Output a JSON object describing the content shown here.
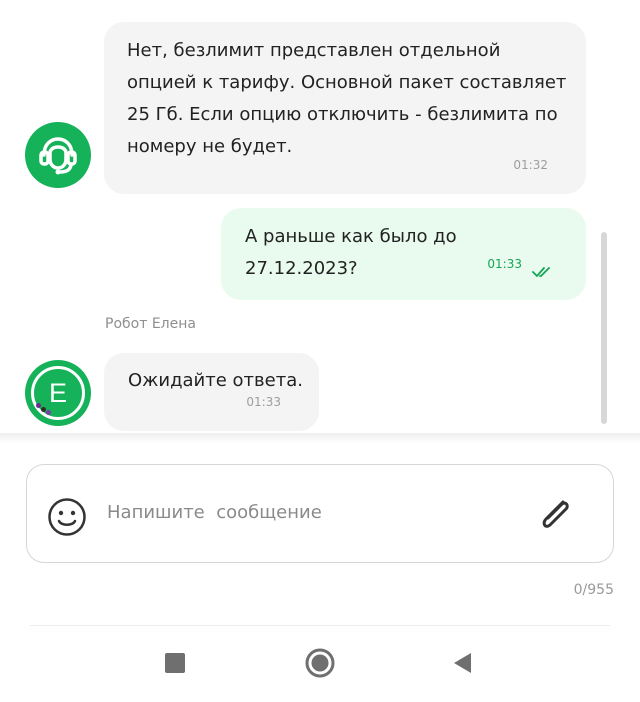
{
  "colors": {
    "brand_green": "#16b25a",
    "incoming_bubble": "#f4f4f4",
    "outgoing_bubble": "#e9fbee",
    "status_read": "#16a556"
  },
  "messages": [
    {
      "direction": "incoming",
      "avatar_icon": "operator-headset-icon",
      "text": "Нет, безлимит представлен отдельной опцией к тарифу. Основной пакет составляет 25 Гб. Если опцию отключить - безлимита по номеру не будет.",
      "lines": [
        "Нет, безлимит представлен отдельной",
        "опцией к тарифу. Основной пакет составляет",
        "25 Гб. Если опцию отключить - безлимита по",
        "номеру не будет."
      ],
      "time": "01:32"
    },
    {
      "direction": "outgoing",
      "text": "А раньше как было до 27.12.2023?",
      "time": "01:33",
      "status_icon": "double-check-icon"
    },
    {
      "direction": "incoming",
      "sender": "Робот Елена",
      "avatar_letter": "E",
      "text": "Ожидайте ответа.",
      "time": "01:33"
    }
  ],
  "composer": {
    "placeholder": "Напишите  сообщение",
    "value": "",
    "emoji_icon": "smiley-icon",
    "attach_icon": "paperclip-icon",
    "counter": "0/955"
  },
  "navbar": {
    "recents_icon": "square-icon",
    "home_icon": "circle-icon",
    "back_icon": "triangle-back-icon"
  }
}
